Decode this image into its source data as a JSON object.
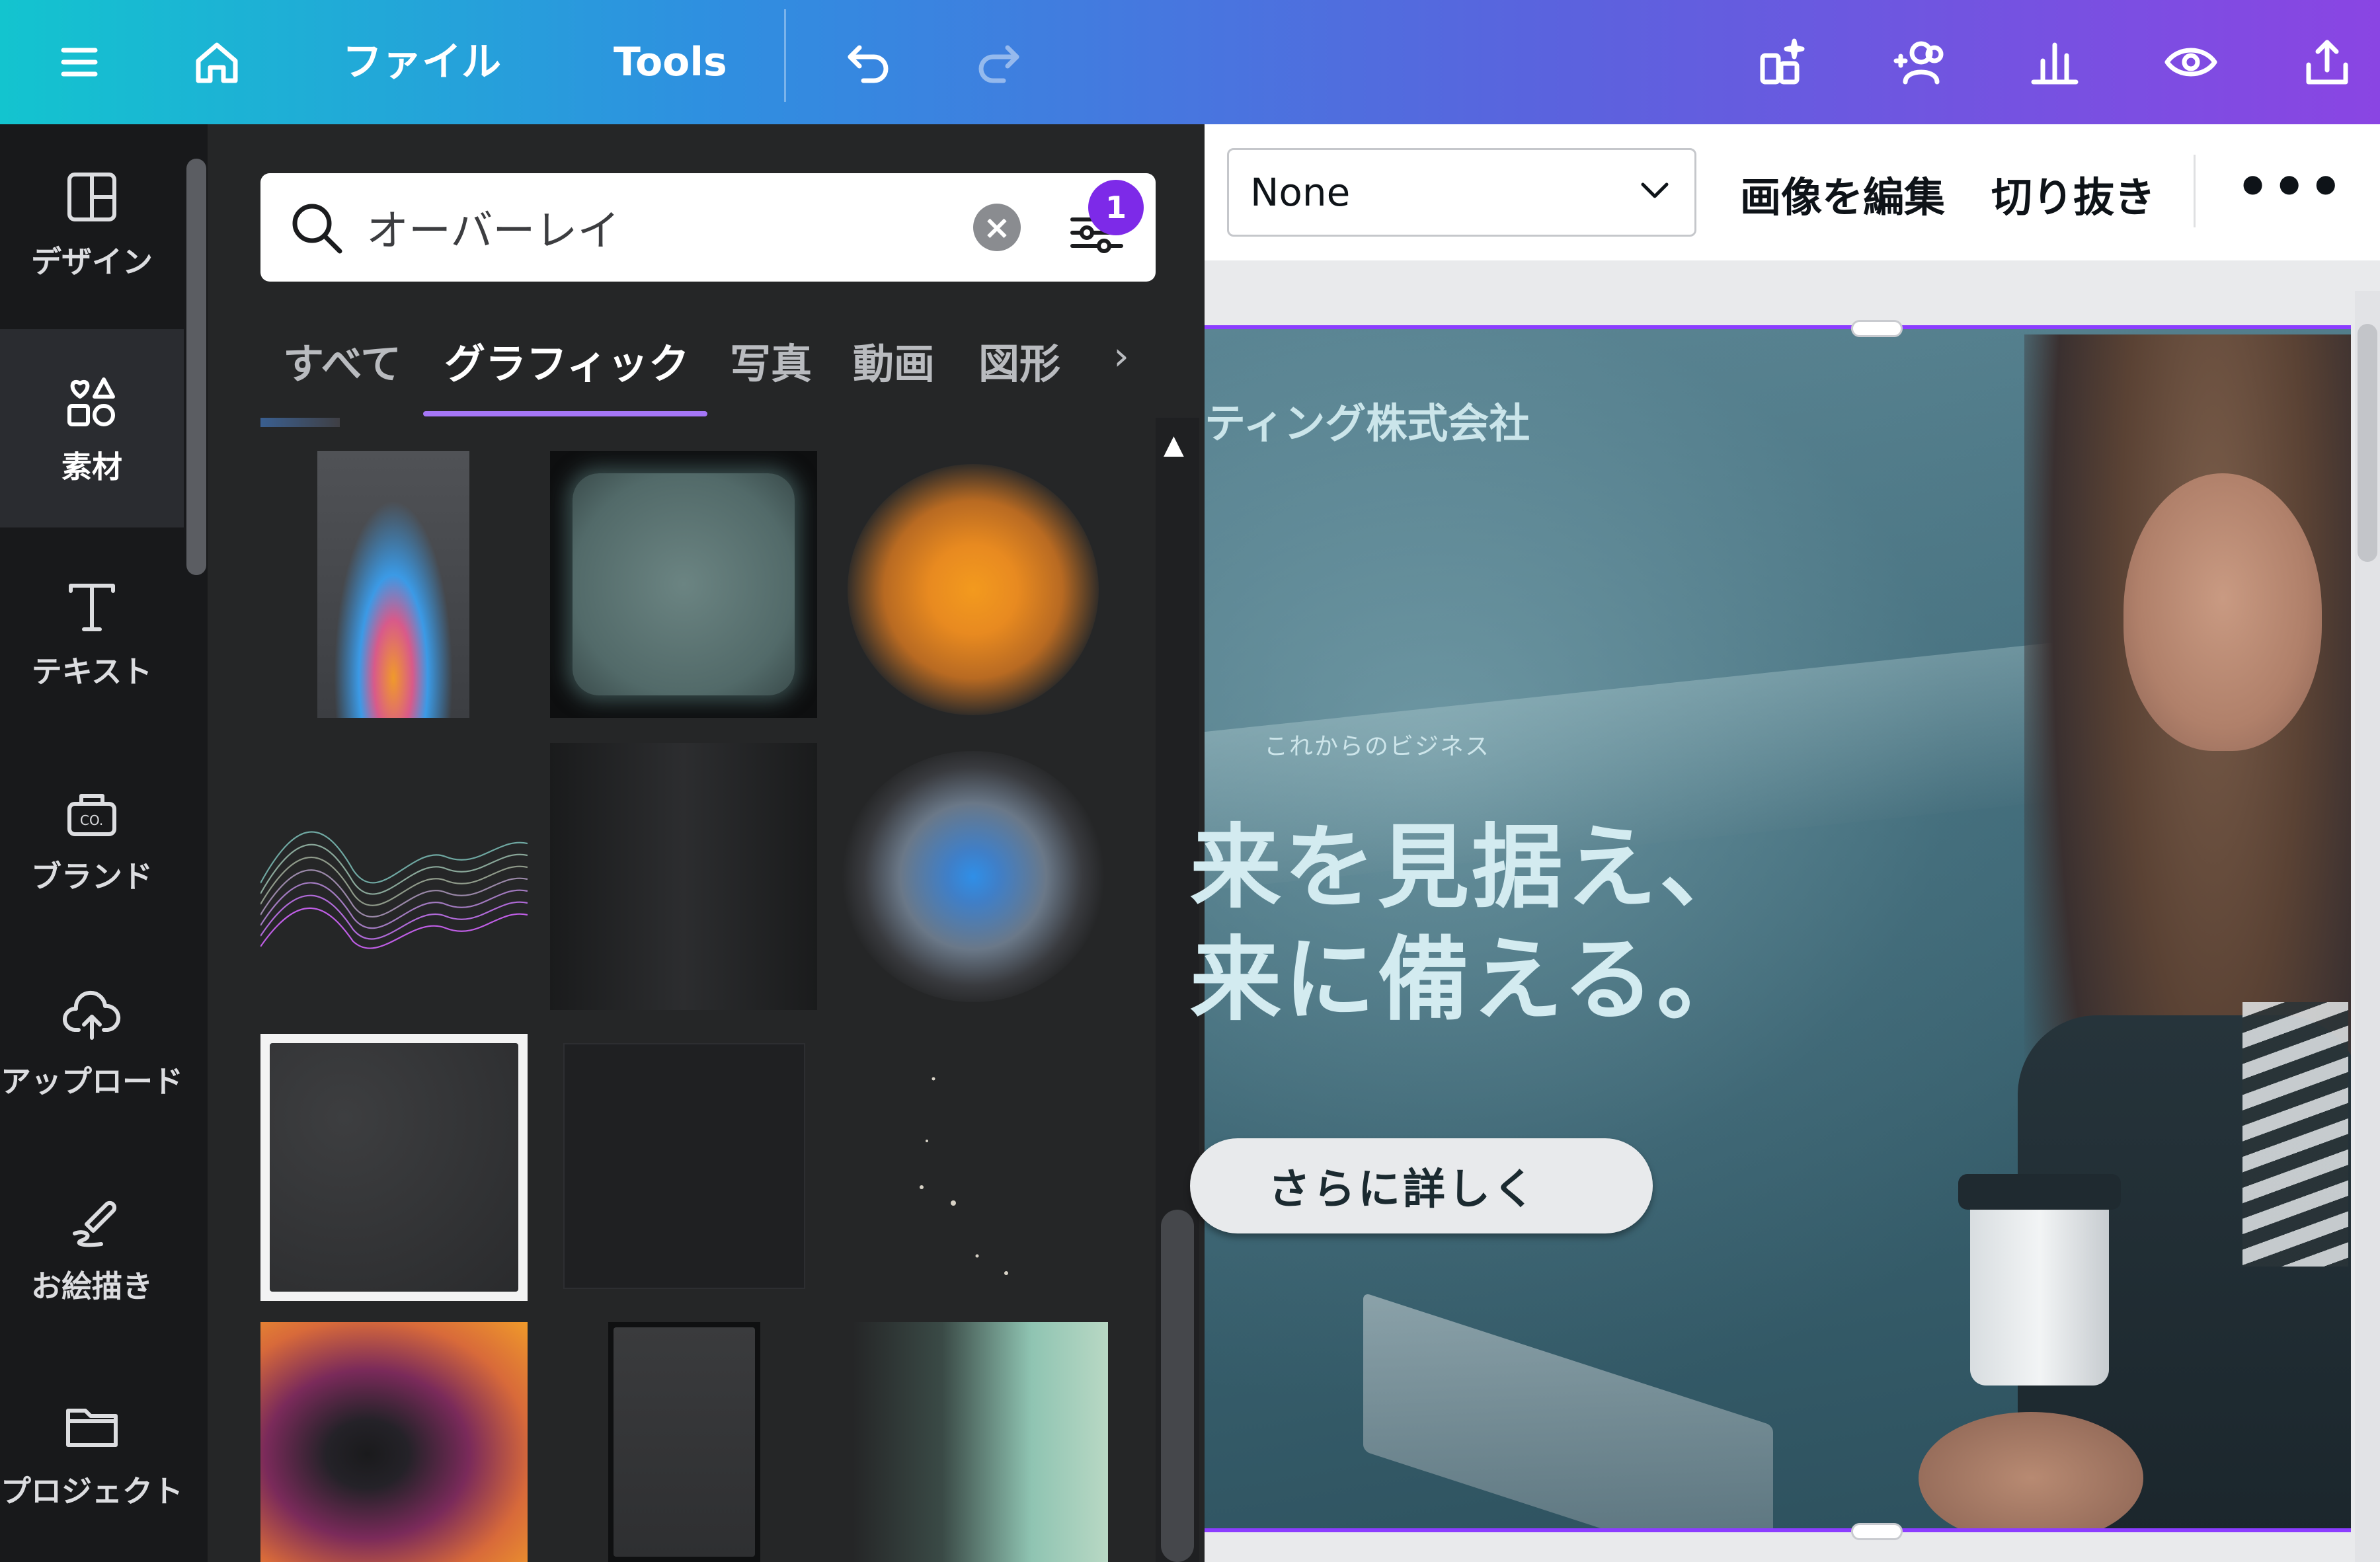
{
  "topbar": {
    "menu_icon": "hamburger-menu-icon",
    "home_icon": "home-icon",
    "file_label": "ファイル",
    "tools_label": "Tools",
    "undo_icon": "undo-icon",
    "redo_icon": "redo-icon",
    "right_icons": [
      "magic-resize-icon",
      "share-people-icon",
      "insights-chart-icon",
      "preview-eye-icon",
      "upload-share-icon"
    ]
  },
  "rail": {
    "items": [
      {
        "label": "デザイン",
        "icon": "layout-icon"
      },
      {
        "label": "素材",
        "icon": "elements-shapes-icon",
        "active": true
      },
      {
        "label": "テキスト",
        "icon": "text-t-icon"
      },
      {
        "label": "ブランド",
        "icon": "brand-kit-icon"
      },
      {
        "label": "アップロード",
        "icon": "cloud-upload-icon"
      },
      {
        "label": "お絵描き",
        "icon": "draw-pen-icon"
      },
      {
        "label": "プロジェクト",
        "icon": "folder-icon"
      }
    ]
  },
  "panel": {
    "search": {
      "value": "オーバーレイ",
      "filter_count": "1"
    },
    "tabs": [
      {
        "label": "すべて"
      },
      {
        "label": "グラフィック",
        "active": true
      },
      {
        "label": "写真"
      },
      {
        "label": "動画"
      },
      {
        "label": "図形"
      }
    ],
    "tab_more_icon": "chevron-right-icon",
    "results": [
      {
        "name": "grainy-rainbow-overlay"
      },
      {
        "name": "teal-rounded-frame-overlay"
      },
      {
        "name": "orange-glow-gradient"
      },
      {
        "name": "wave-line-gradient"
      },
      {
        "name": "dark-vignette-overlay"
      },
      {
        "name": "blue-glow-gradient"
      },
      {
        "name": "dust-texture-framed"
      },
      {
        "name": "dark-square-overlay"
      },
      {
        "name": "scattered-particles"
      },
      {
        "name": "warm-blur-gradient"
      },
      {
        "name": "dark-paper-texture"
      },
      {
        "name": "mint-blur-photo"
      }
    ]
  },
  "context_toolbar": {
    "select_value": "None",
    "edit_image": "画像を編集",
    "crop": "切り抜き",
    "more": "•••"
  },
  "design": {
    "company": "ティング株式会社",
    "kicker": "これからのビジネス",
    "headline_1": "来を見据え、",
    "headline_2": "来に備える。",
    "cta": "さらに詳しく"
  },
  "colors": {
    "accent_purple": "#8b3dff",
    "badge_purple": "#7d2ae8",
    "tab_underline": "#a576f6",
    "panel_bg": "#252627",
    "rail_bg": "#18191b"
  }
}
